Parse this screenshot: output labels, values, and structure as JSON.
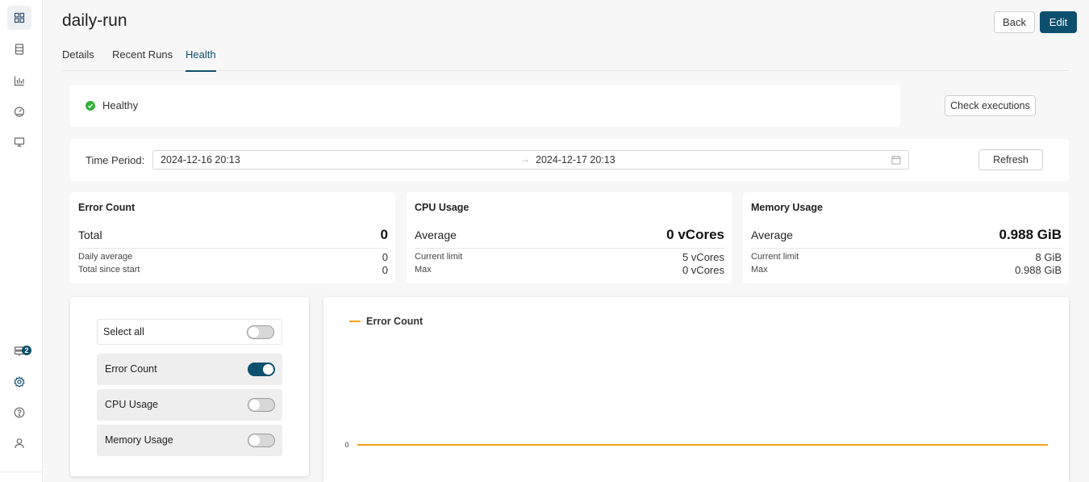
{
  "app": {
    "title": "daily-run"
  },
  "header": {
    "back_label": "Back",
    "edit_label": "Edit"
  },
  "sidebar": {
    "items": [
      {
        "icon": "dashboard-icon",
        "active": true
      },
      {
        "icon": "database-icon"
      },
      {
        "icon": "bar-chart-icon"
      },
      {
        "icon": "gauge-icon"
      },
      {
        "icon": "monitor-icon"
      },
      {
        "icon": "notifications-icon",
        "badge": "2"
      },
      {
        "icon": "gear-icon"
      },
      {
        "icon": "help-icon"
      },
      {
        "icon": "user-icon"
      }
    ]
  },
  "tabs": [
    {
      "label": "Details"
    },
    {
      "label": "Recent Runs"
    },
    {
      "label": "Health",
      "active": true
    }
  ],
  "status": {
    "text": "Healthy",
    "color": "#35b13a",
    "check_label": "Check executions"
  },
  "time_period": {
    "label": "Time Period:",
    "start": "2024-12-16 20:13",
    "end": "2024-12-17 20:13",
    "arrow": "→",
    "refresh_label": "Refresh"
  },
  "metrics": {
    "error": {
      "title": "Error Count",
      "main_label": "Total",
      "main_value": "0",
      "row1_label": "Daily average",
      "row1_value": "0",
      "row2_label": "Total since start",
      "row2_value": "0"
    },
    "cpu": {
      "title": "CPU Usage",
      "main_label": "Average",
      "main_value": "0 vCores",
      "row1_label": "Current limit",
      "row1_value": "5 vCores",
      "row2_label": "Max",
      "row2_value": "0 vCores"
    },
    "memory": {
      "title": "Memory Usage",
      "main_label": "Average",
      "main_value": "0.988 GiB",
      "row1_label": "Current limit",
      "row1_value": "8 GiB",
      "row2_label": "Max",
      "row2_value": "0.988 GiB"
    }
  },
  "series_selector": {
    "select_all": {
      "label": "Select all",
      "on": false
    },
    "items": [
      {
        "label": "Error Count",
        "on": true
      },
      {
        "label": "CPU Usage",
        "on": false
      },
      {
        "label": "Memory Usage",
        "on": false
      }
    ]
  },
  "chart_data": {
    "type": "line",
    "title": "",
    "xlabel": "",
    "ylabel": "",
    "y_ticks": [
      "0"
    ],
    "legend_position": "top-left",
    "series": [
      {
        "name": "Error Count",
        "color": "#f0a21a",
        "values": [
          0,
          0
        ]
      }
    ]
  }
}
